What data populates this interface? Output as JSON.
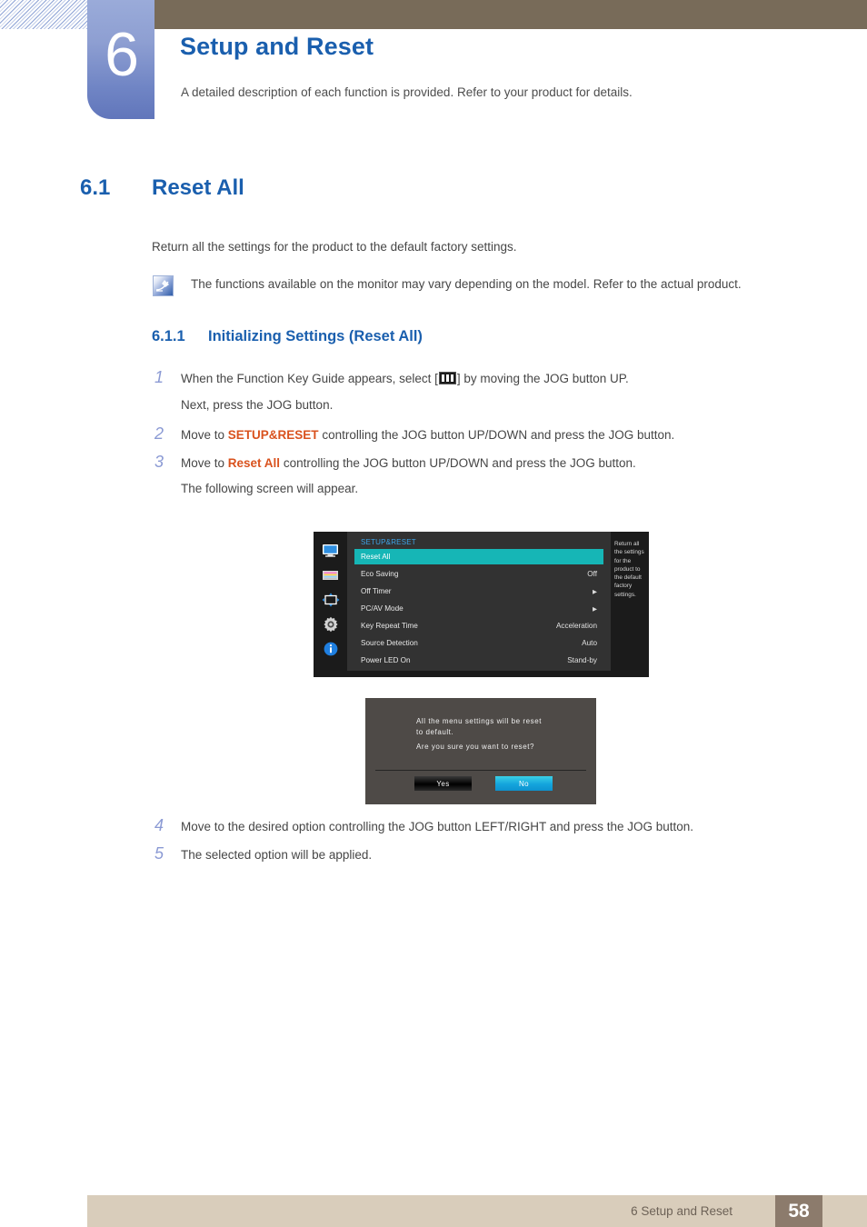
{
  "chapter": {
    "number": "6",
    "title": "Setup and Reset",
    "description": "A detailed description of each function is provided. Refer to your product for details."
  },
  "section": {
    "number": "6.1",
    "title": "Reset All",
    "intro": "Return all the settings for the product to the default factory settings.",
    "note": "The functions available on the monitor may vary depending on the model. Refer to the actual product."
  },
  "subsection": {
    "number": "6.1.1",
    "title": "Initializing Settings (Reset All)"
  },
  "steps": [
    {
      "n": "1",
      "pre": "When the Function Key Guide appears, select [",
      "post": "] by moving the JOG button UP.",
      "line2": "Next, press the JOG button."
    },
    {
      "n": "2",
      "pre": "Move to ",
      "highlight": "SETUP&RESET",
      "post": " controlling the JOG button UP/DOWN and press the JOG button."
    },
    {
      "n": "3",
      "pre": "Move to ",
      "highlight": "Reset All",
      "post": " controlling the JOG button UP/DOWN and press the JOG button.",
      "line2": "The following screen will appear."
    },
    {
      "n": "4",
      "text": "Move to the desired option controlling the JOG button LEFT/RIGHT and press the JOG button."
    },
    {
      "n": "5",
      "text": "The selected option will be applied."
    }
  ],
  "osd": {
    "title": "SETUP&RESET",
    "sidebar_icons": [
      "monitor-icon",
      "color-bars-icon",
      "screen-adjust-icon",
      "gear-icon",
      "info-icon"
    ],
    "rows": [
      {
        "label": "Reset All",
        "value": "",
        "selected": true,
        "arrow": false
      },
      {
        "label": "Eco Saving",
        "value": "Off",
        "selected": false,
        "arrow": false
      },
      {
        "label": "Off Timer",
        "value": "",
        "selected": false,
        "arrow": true
      },
      {
        "label": "PC/AV Mode",
        "value": "",
        "selected": false,
        "arrow": true
      },
      {
        "label": "Key Repeat Time",
        "value": "Acceleration",
        "selected": false,
        "arrow": false
      },
      {
        "label": "Source Detection",
        "value": "Auto",
        "selected": false,
        "arrow": false
      },
      {
        "label": "Power LED On",
        "value": "Stand-by",
        "selected": false,
        "arrow": false
      }
    ],
    "description": "Return all the settings for the product to the default factory settings."
  },
  "dialog": {
    "line1": "All the menu settings will be reset",
    "line2": "to default.",
    "line3": "Are you sure you want to reset?",
    "yes_label": "Yes",
    "no_label": "No"
  },
  "footer": {
    "text": "6 Setup and Reset",
    "page": "58"
  },
  "colors": {
    "heading_blue": "#1a5fae",
    "highlight_orange": "#d9521e",
    "step_number": "#8b9ad4",
    "header_brown": "#786b59",
    "footer_bar": "#d9cdbb",
    "footer_page": "#8c7b6c",
    "osd_selected": "#16b6b6",
    "osd_title_blue": "#3da4e8"
  }
}
